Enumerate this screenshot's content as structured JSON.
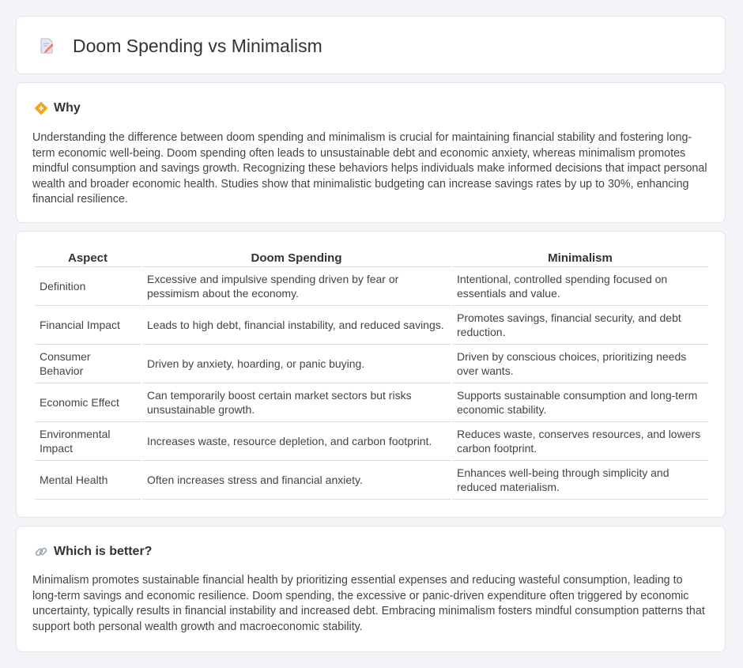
{
  "header": {
    "title": "Doom Spending vs Minimalism",
    "icon": "document-pencil-icon"
  },
  "why": {
    "heading": "Why",
    "icon": "diamond-arrows-icon",
    "text": "Understanding the difference between doom spending and minimalism is crucial for maintaining financial stability and fostering long-term economic well-being. Doom spending often leads to unsustainable debt and economic anxiety, whereas minimalism promotes mindful consumption and savings growth. Recognizing these behaviors helps individuals make informed decisions that impact personal wealth and broader economic health. Studies show that minimalistic budgeting can increase savings rates by up to 30%, enhancing financial resilience."
  },
  "comparison": {
    "headers": [
      "Aspect",
      "Doom Spending",
      "Minimalism"
    ],
    "rows": [
      [
        "Definition",
        "Excessive and impulsive spending driven by fear or pessimism about the economy.",
        "Intentional, controlled spending focused on essentials and value."
      ],
      [
        "Financial Impact",
        "Leads to high debt, financial instability, and reduced savings.",
        "Promotes savings, financial security, and debt reduction."
      ],
      [
        "Consumer Behavior",
        "Driven by anxiety, hoarding, or panic buying.",
        "Driven by conscious choices, prioritizing needs over wants."
      ],
      [
        "Economic Effect",
        "Can temporarily boost certain market sectors but risks unsustainable growth.",
        "Supports sustainable consumption and long-term economic stability."
      ],
      [
        "Environmental Impact",
        "Increases waste, resource depletion, and carbon footprint.",
        "Reduces waste, conserves resources, and lowers carbon footprint."
      ],
      [
        "Mental Health",
        "Often increases stress and financial anxiety.",
        "Enhances well-being through simplicity and reduced materialism."
      ]
    ]
  },
  "better": {
    "heading": "Which is better?",
    "icon": "link-icon",
    "text": "Minimalism promotes sustainable financial health by prioritizing essential expenses and reducing wasteful consumption, leading to long-term savings and economic resilience. Doom spending, the excessive or panic-driven expenditure often triggered by economic uncertainty, typically results in financial instability and increased debt. Embracing minimalism fosters mindful consumption patterns that support both personal wealth growth and macroeconomic stability."
  }
}
